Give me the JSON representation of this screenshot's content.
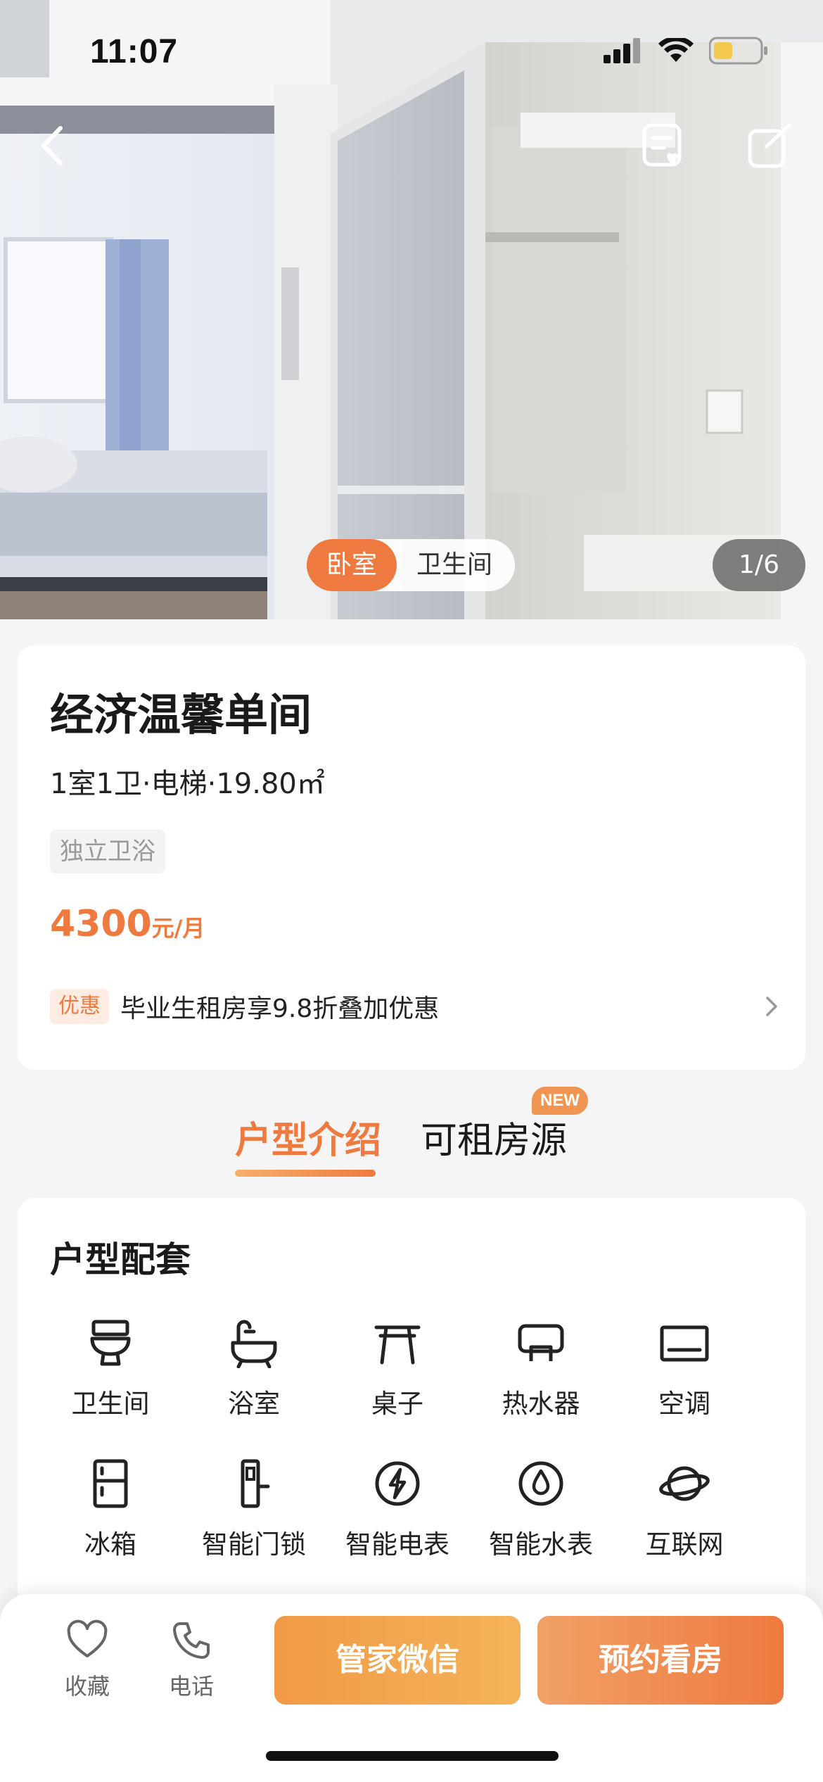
{
  "status_bar": {
    "time": "11:07"
  },
  "hero": {
    "room_tabs": [
      "卧室",
      "卫生间"
    ],
    "active_room_tab": 0,
    "photo_counter": "1/6",
    "photo_subject": "bedroom-with-bathroom-photo"
  },
  "listing": {
    "title": "经济温馨单间",
    "meta": "1室1卫·电梯·19.80㎡",
    "tag": "独立卫浴",
    "price_value": "4300",
    "price_unit": "元/月",
    "promo_badge": "优惠",
    "promo_text": "毕业生租房享9.8折叠加优惠"
  },
  "tabs": {
    "items": [
      "户型介绍",
      "可租房源"
    ],
    "active": 0,
    "new_badge": "NEW"
  },
  "amenities": {
    "heading": "户型配套",
    "items": [
      {
        "label": "卫生间",
        "icon": "toilet-icon"
      },
      {
        "label": "浴室",
        "icon": "bathtub-icon"
      },
      {
        "label": "桌子",
        "icon": "table-icon"
      },
      {
        "label": "热水器",
        "icon": "water-heater-icon"
      },
      {
        "label": "空调",
        "icon": "air-conditioner-icon"
      },
      {
        "label": "冰箱",
        "icon": "fridge-icon"
      },
      {
        "label": "智能门锁",
        "icon": "smart-lock-icon"
      },
      {
        "label": "智能电表",
        "icon": "smart-meter-icon"
      },
      {
        "label": "智能水表",
        "icon": "water-meter-icon"
      },
      {
        "label": "互联网",
        "icon": "internet-icon"
      }
    ]
  },
  "bottom_bar": {
    "favorite_label": "收藏",
    "phone_label": "电话",
    "wechat_button": "管家微信",
    "book_button": "预约看房"
  },
  "colors": {
    "accent": "#ee7a3f",
    "accent_light": "#f4b35a",
    "background": "#f5f5f5"
  }
}
